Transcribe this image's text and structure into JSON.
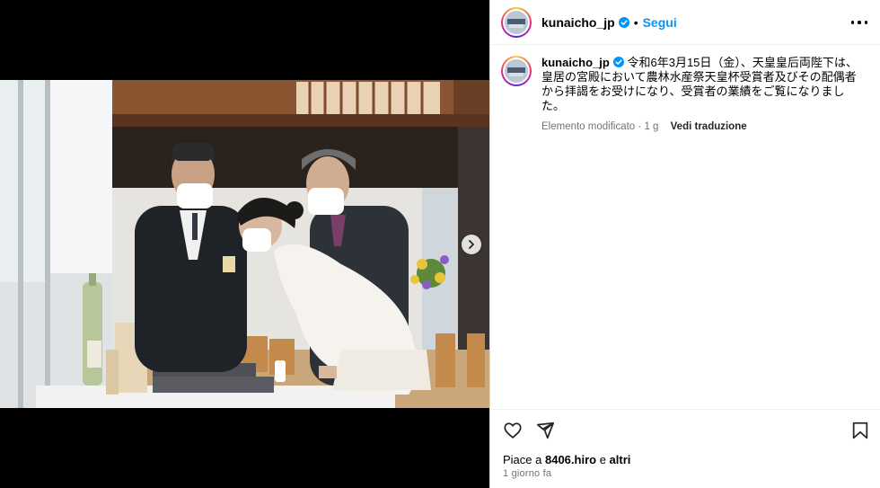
{
  "post": {
    "username": "kunaicho_jp",
    "follow_label": "Segui",
    "separator": "•",
    "caption": "令和6年3月15日（金）、天皇皇后両陛下は、皇居の宮殿において農林水産祭天皇杯受賞者及びその配偶者から拝謁をお受けになり、受賞者の業績をご覧になりました。",
    "edited_label": "Elemento modificato",
    "meta_sep": " · ",
    "age_short": "1 g",
    "translate_label": "Vedi traduzione",
    "likes_prefix": "Piace a ",
    "likes_user": "8406.hiro",
    "likes_mid": " e ",
    "likes_suffix": "altri",
    "time_label": "1 giorno fa"
  },
  "icons": {
    "verified": "verified-badge-icon",
    "more": "more-options-icon",
    "next": "chevron-right-icon",
    "like": "heart-icon",
    "share": "paper-plane-icon",
    "save": "bookmark-icon"
  },
  "colors": {
    "accent": "#0095f6",
    "muted": "#737373",
    "divider": "#dbdbdb"
  }
}
